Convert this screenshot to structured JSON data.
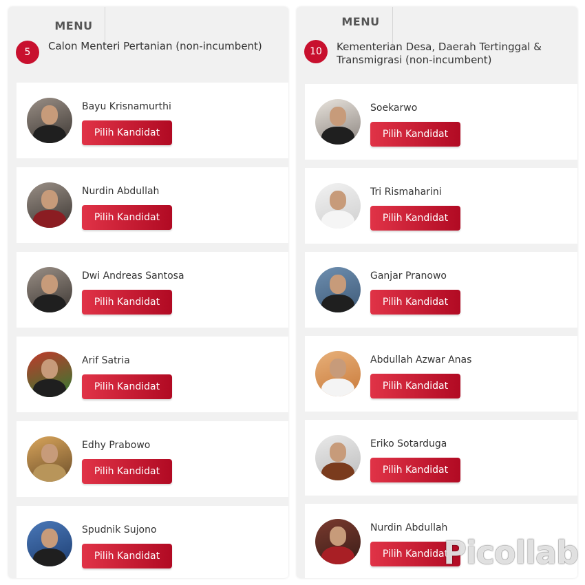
{
  "left_panel": {
    "menu_label": "MENU",
    "number": "5",
    "category_title": "Calon Menteri Pertanian (non-incumbent)",
    "candidates": [
      {
        "name": "Bayu Krisnamurthi",
        "button": "Pilih Kandidat"
      },
      {
        "name": "Nurdin Abdullah",
        "button": "Pilih Kandidat"
      },
      {
        "name": "Dwi Andreas Santosa",
        "button": "Pilih Kandidat"
      },
      {
        "name": "Arif Satria",
        "button": "Pilih Kandidat"
      },
      {
        "name": "Edhy Prabowo",
        "button": "Pilih Kandidat"
      },
      {
        "name": "Spudnik Sujono",
        "button": "Pilih Kandidat"
      }
    ]
  },
  "right_panel": {
    "menu_label": "MENU",
    "number": "10",
    "category_title": "Kementerian Desa, Daerah Tertinggal & Transmigrasi (non-incumbent)",
    "candidates": [
      {
        "name": "Soekarwo",
        "button": "Pilih Kandidat"
      },
      {
        "name": "Tri Rismaharini",
        "button": "Pilih Kandidat"
      },
      {
        "name": "Ganjar Pranowo",
        "button": "Pilih Kandidat"
      },
      {
        "name": "Abdullah Azwar Anas",
        "button": "Pilih Kandidat"
      },
      {
        "name": "Eriko Sotarduga",
        "button": "Pilih Kandidat"
      },
      {
        "name": "Nurdin Abdullah",
        "button": "Pilih Kandidat"
      }
    ]
  },
  "watermark": "Picollab",
  "colors": {
    "accent": "#c8102e",
    "button_gradient_start": "#e03347",
    "button_gradient_end": "#b10a23",
    "panel_bg": "#f1f1f1"
  }
}
